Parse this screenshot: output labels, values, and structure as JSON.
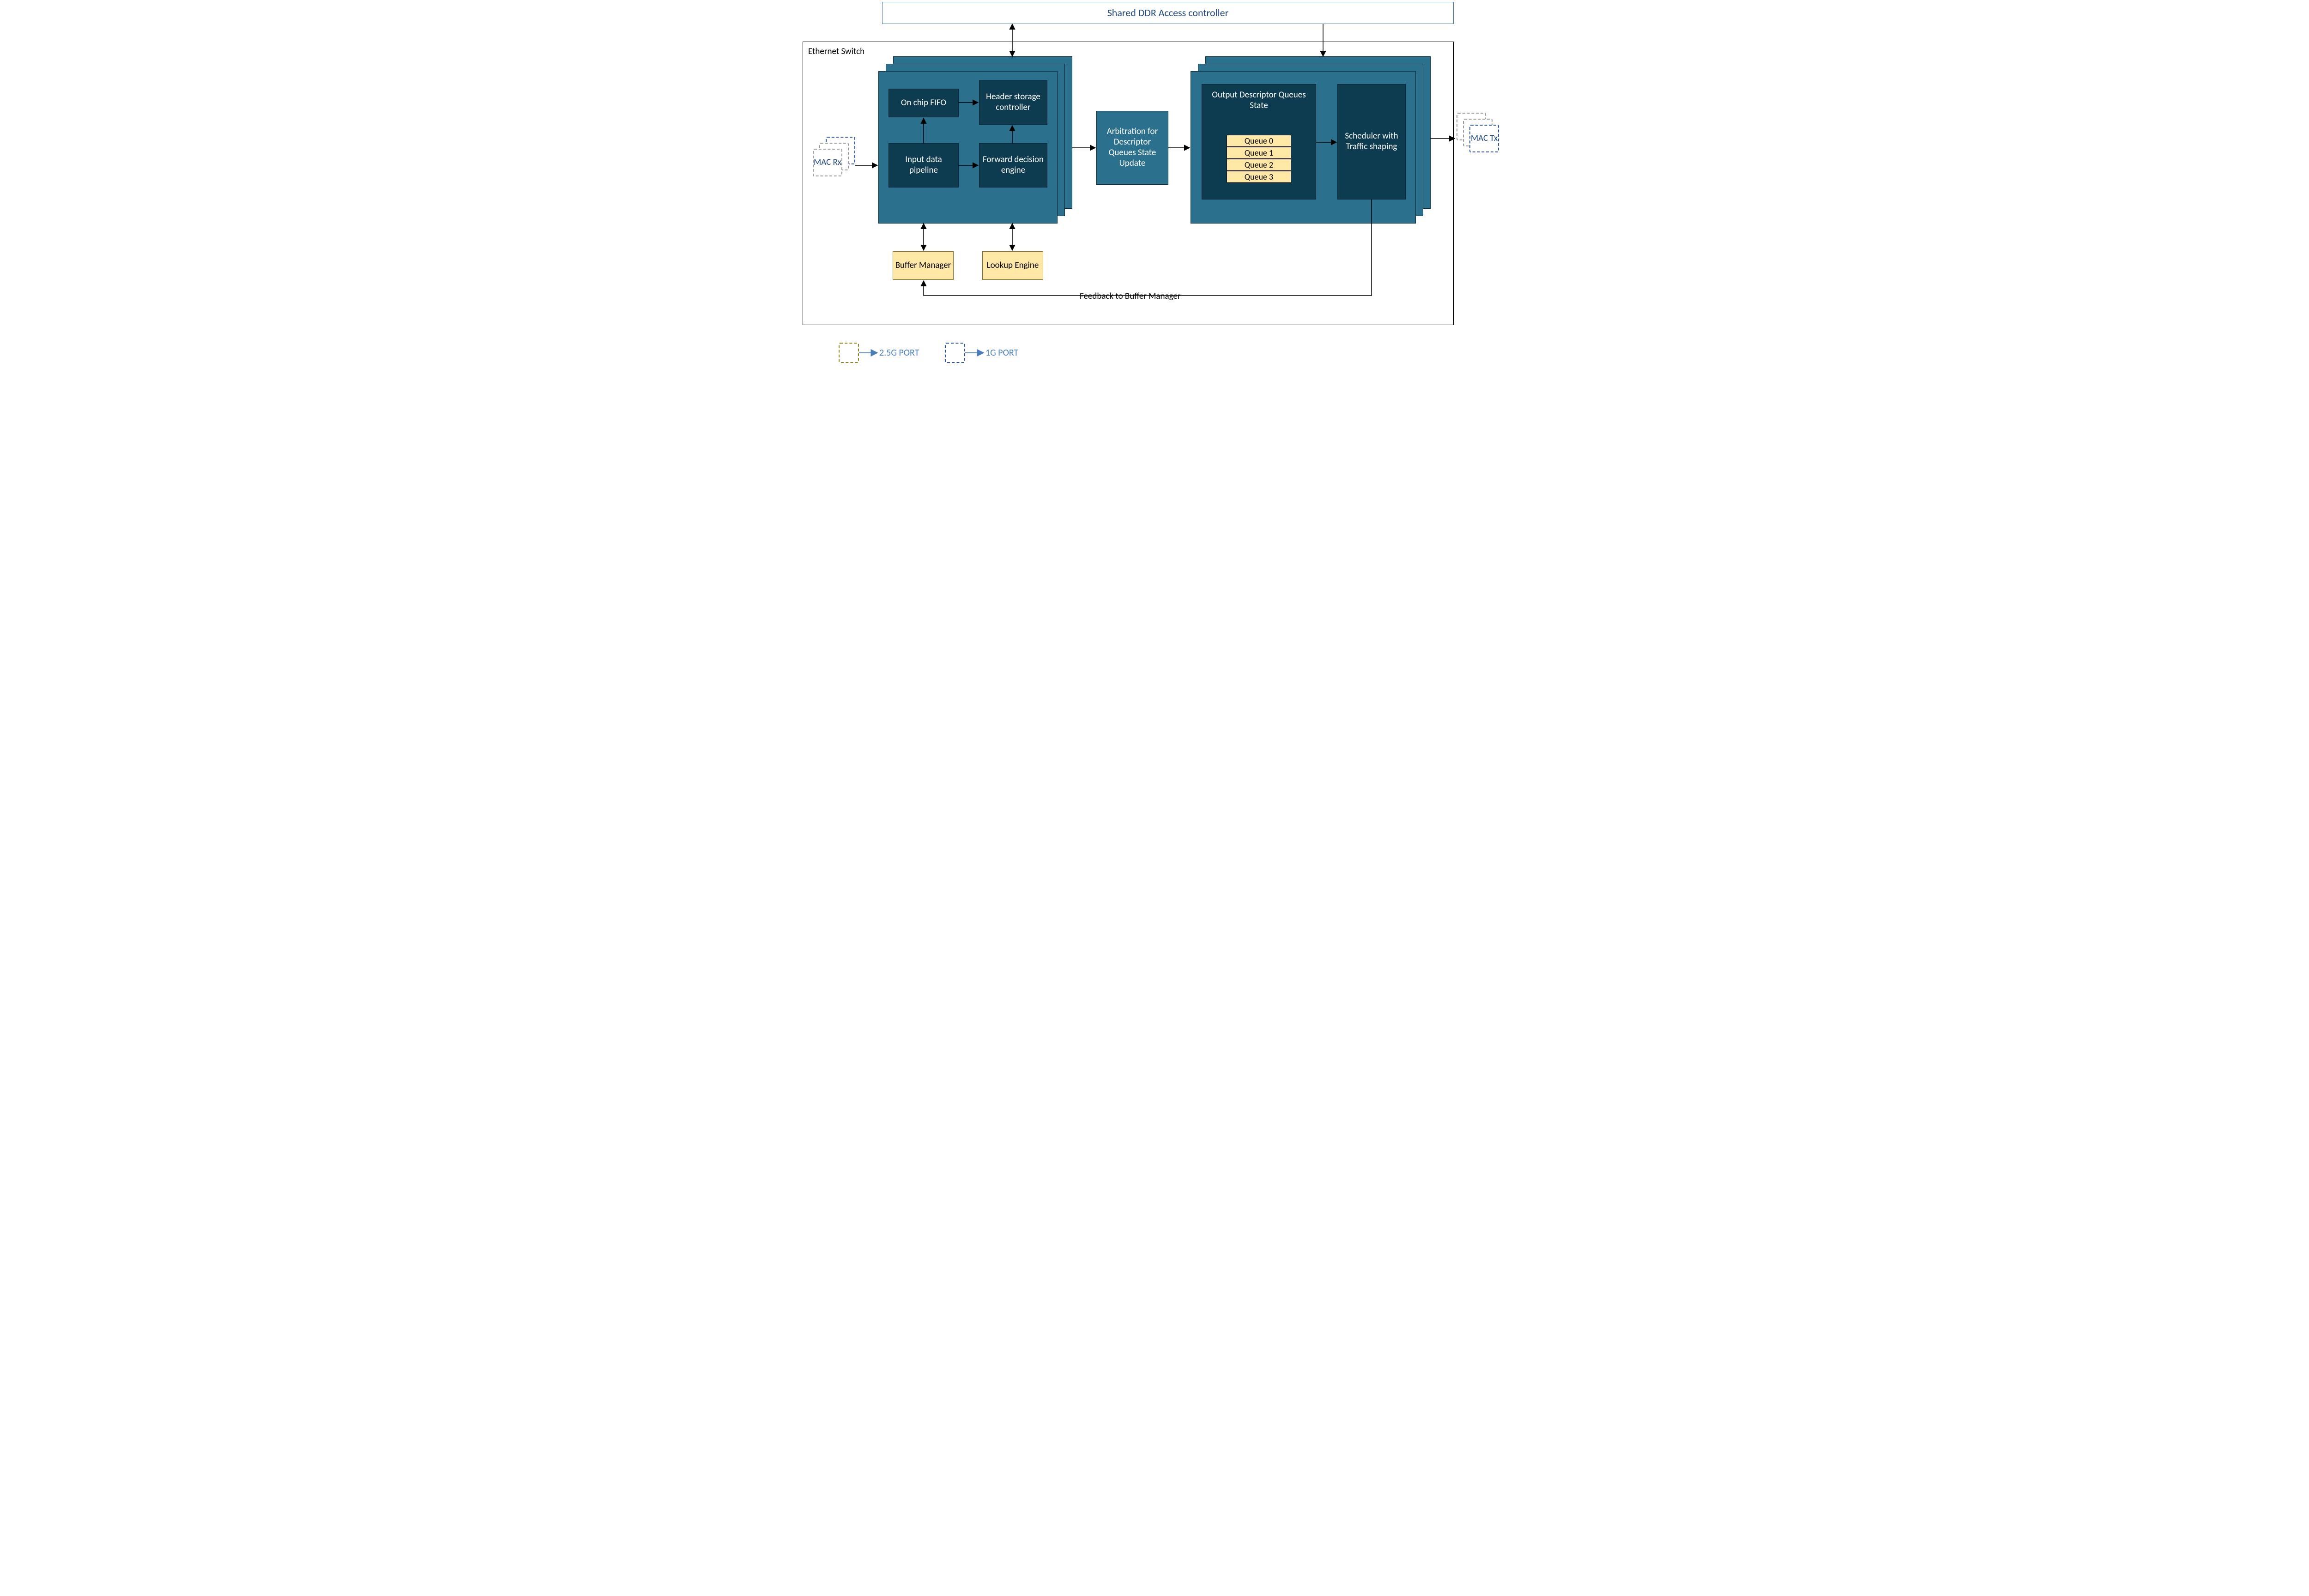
{
  "ddr": {
    "title": "Shared DDR Access controller"
  },
  "switch": {
    "label": "Ethernet Switch"
  },
  "left_card": {
    "fifo": "On chip FIFO",
    "header": "Header storage controller",
    "pipeline": "Input data pipeline",
    "forward": "Forward decision engine"
  },
  "arbitration": "Arbitration for Descriptor Queues State Update",
  "right_card": {
    "queues_title": "Output Descriptor Queues State",
    "queues": [
      "Queue 0",
      "Queue 1",
      "Queue 2",
      "Queue 3"
    ],
    "scheduler": "Scheduler with Traffic shaping"
  },
  "buffer_mgr": "Buffer Manager",
  "lookup": "Lookup Engine",
  "feedback": "Feedback to Buffer Manager",
  "mac_rx": "MAC Rx",
  "mac_tx": "MAC Tx",
  "legend": {
    "port25": "2.5G PORT",
    "port1": "1G PORT"
  },
  "colors": {
    "blue_accent": "#4a7ebb",
    "blue_dark": "#1f497d",
    "teal_mid": "#2b708d",
    "teal_dark": "#0d3b4f",
    "cream": "#ffe8a6",
    "grey_dash": "#9a9a9a",
    "olive_dash": "#8e8522",
    "blue_dash": "#2f5597"
  }
}
